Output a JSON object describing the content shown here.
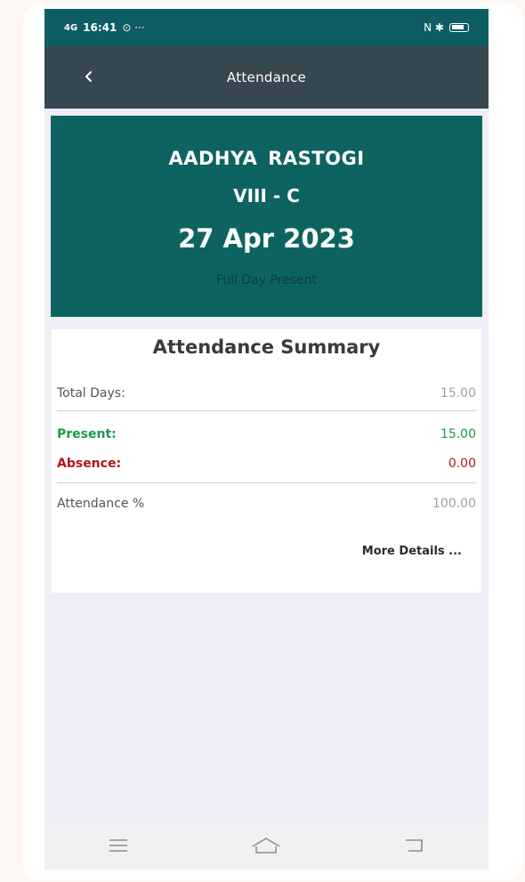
{
  "status_bar": {
    "time": "16:41",
    "signal": "4G",
    "extra": "⊙ ···",
    "right_icons": "N ✱"
  },
  "app_bar": {
    "title": "Attendance"
  },
  "student": {
    "name": "AADHYA  RASTOGI",
    "class": "VIII - C",
    "date": "27 Apr 2023",
    "status": "Full Day Present"
  },
  "summary": {
    "title": "Attendance Summary",
    "total_label": "Total Days:",
    "total_value": "15.00",
    "present_label": "Present:",
    "present_value": "15.00",
    "absence_label": "Absence:",
    "absence_value": "0.00",
    "percent_label": "Attendance %",
    "percent_value": "100.00",
    "more_label": "More Details ..."
  },
  "colors": {
    "status_bar": "#0e5d64",
    "app_bar": "#37474f",
    "hero": "#0d6360",
    "present": "#1a9a4a",
    "absence": "#b2141c"
  }
}
